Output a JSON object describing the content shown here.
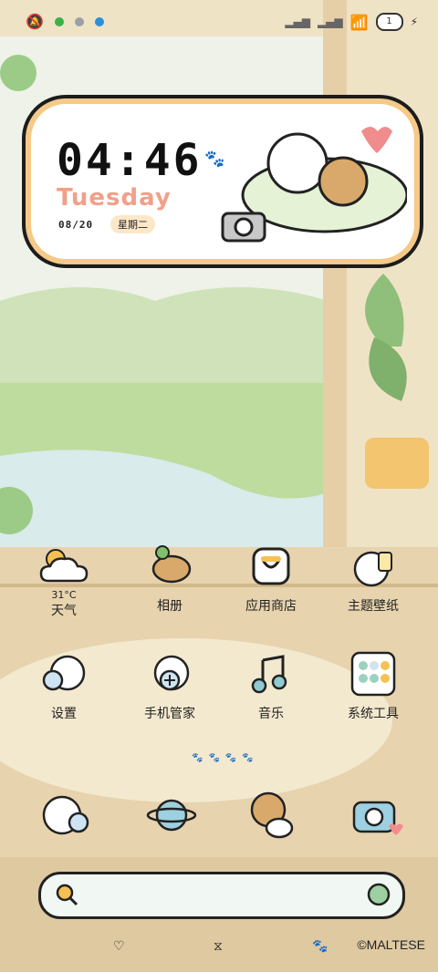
{
  "status_bar": {
    "icons": [
      "mute-icon",
      "app-notification-icon",
      "app-notification-icon",
      "app-notification-icon"
    ],
    "battery_level": "1"
  },
  "widget": {
    "time": "04:46",
    "day": "Tuesday",
    "date": "08/20",
    "weekday_cn": "星期二"
  },
  "weather": {
    "temp": "31°C",
    "label": "天气"
  },
  "apps_row1": [
    {
      "label": "相册"
    },
    {
      "label": "应用商店"
    },
    {
      "label": "主题壁纸"
    }
  ],
  "apps_row2": [
    {
      "label": "设置"
    },
    {
      "label": "手机管家"
    },
    {
      "label": "音乐"
    },
    {
      "label": "系统工具"
    }
  ],
  "dock": [
    "phone-icon",
    "browser-icon",
    "messages-icon",
    "camera-icon"
  ],
  "footer": {
    "copyright": "©MALTESE"
  }
}
